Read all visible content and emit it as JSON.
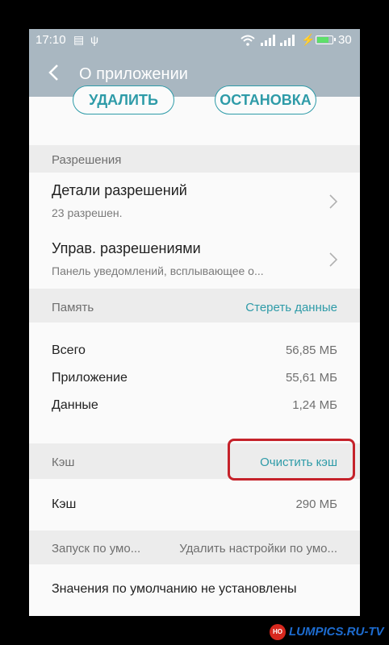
{
  "status_bar": {
    "time": "17:10",
    "battery_percent": "30",
    "battery_level": 0.8
  },
  "app_bar": {
    "title": "О приложении"
  },
  "actions": {
    "delete_label": "УДАЛИТЬ",
    "stop_label": "ОСТАНОВКА"
  },
  "permissions": {
    "header": "Разрешения",
    "details_title": "Детали разрешений",
    "details_sub": "23 разрешен.",
    "manage_title": "Управ. разрешениями",
    "manage_sub": "Панель уведомлений, всплывающее о..."
  },
  "memory": {
    "header": "Память",
    "clear_data_label": "Стереть данные",
    "rows": [
      {
        "label": "Всего",
        "value": "56,85 МБ"
      },
      {
        "label": "Приложение",
        "value": "55,61 МБ"
      },
      {
        "label": "Данные",
        "value": "1,24 МБ"
      }
    ]
  },
  "cache": {
    "header": "Кэш",
    "clear_cache_label": "Очистить кэш",
    "row_label": "Кэш",
    "row_value": "290 МБ"
  },
  "defaults": {
    "header": "Запуск по умо...",
    "clear_defaults_label": "Удалить настройки по умо...",
    "info": "Значения по умолчанию не установлены"
  },
  "watermark": {
    "logo_text": "НО",
    "text": "LUMPICS.RU-TV"
  },
  "colors": {
    "accent": "#2e9ba8",
    "appbar": "#a9b7c1",
    "highlight": "#c5222a"
  }
}
